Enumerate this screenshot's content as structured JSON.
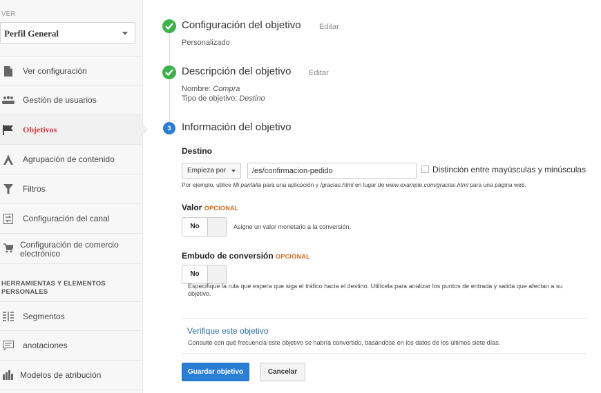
{
  "sidebar": {
    "ver_label": "VER",
    "profile": "Perfil General",
    "items": [
      {
        "label": "Ver configuración",
        "icon": "document-icon"
      },
      {
        "label": "Gestión de usuarios",
        "icon": "users-icon"
      },
      {
        "label": "Objetivos",
        "icon": "flag-icon",
        "active": true
      },
      {
        "label": "Agrupación de contenido",
        "icon": "grouping-icon"
      },
      {
        "label": "Filtros",
        "icon": "filter-icon"
      },
      {
        "label": "Configuración del canal",
        "icon": "channel-icon"
      },
      {
        "label": "Configuración de comercio electrónico",
        "icon": "cart-icon"
      }
    ],
    "tools_title": "HERRAMIENTAS Y ELEMENTOS PERSONALES",
    "tools": [
      {
        "label": "Segmentos",
        "icon": "segments-icon"
      },
      {
        "label": "anotaciones",
        "icon": "annotation-icon"
      },
      {
        "label": "Modelos de atribución",
        "icon": "bar-chart-icon"
      }
    ]
  },
  "steps": {
    "config": {
      "title": "Configuración del objetivo",
      "edit": "Editar",
      "value": "Personalizado"
    },
    "description": {
      "title": "Descripción del objetivo",
      "edit": "Editar",
      "name_label": "Nombre:",
      "name_value": "Compra",
      "type_label": "Tipo de objetivo:",
      "type_value": "Destino"
    },
    "info": {
      "number": "3",
      "title": "Información del objetivo"
    }
  },
  "destination": {
    "label": "Destino",
    "match_type": "Empieza por",
    "url": "/es/confirmacion-pedido",
    "case_label": "Distinción entre mayúsculas y minúsculas",
    "hint_1": "Por ejemplo, utilice ",
    "hint_2": "Mi pantalla",
    "hint_3": " para una aplicación y ",
    "hint_4": "/gracias.html",
    "hint_5": " en lugar de ",
    "hint_6": "www.example.com/gracias.html",
    "hint_7": " para una página web."
  },
  "value": {
    "label": "Valor",
    "optional": "OPCIONAL",
    "toggle": "No",
    "desc": "Asigne un valor monetario a la conversión."
  },
  "funnel": {
    "label": "Embudo de conversión",
    "optional": "OPCIONAL",
    "toggle": "No",
    "desc": "Especifique la ruta que espera que siga el tráfico hacia el destino. Utilícela para analizar los puntos de entrada y salida que afectan a su objetivo."
  },
  "verify": {
    "link": "Verifique este objetivo",
    "desc": "Consulte con qué frecuencia este objetivo se habría convertido, basándose en los datos de los últimos siete días."
  },
  "buttons": {
    "save": "Guardar objetivo",
    "cancel": "Cancelar"
  },
  "colors": {
    "accent_blue": "#2a7fd4",
    "success_green": "#3bb34a",
    "active_red": "#e1343f",
    "optional_orange": "#d06a1a"
  }
}
